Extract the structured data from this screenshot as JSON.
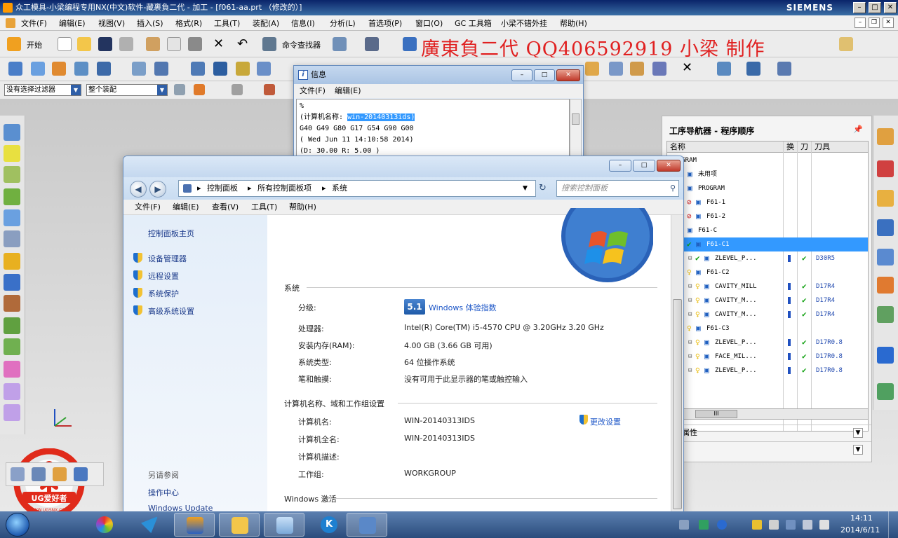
{
  "nx": {
    "title": "众工模具-小梁编程专用NX(中文)软件-藏裹負二代 - 加工 - [f061-aa.prt （修改的）]",
    "brand": "SIEMENS",
    "menu": [
      "文件(F)",
      "编辑(E)",
      "视图(V)",
      "插入(S)",
      "格式(R)",
      "工具(T)",
      "装配(A)",
      "信息(I)",
      "分析(L)",
      "首选项(P)",
      "窗口(O)",
      "GC 工具箱",
      "小梁不错外挂",
      "帮助(H)"
    ],
    "toolbar": {
      "start_label": "开始",
      "command_finder_label": "命令查找器"
    },
    "watermark_text": "廣東負二代 QQ406592919 小梁 制作",
    "selection_filter": "没有选择过滤器",
    "assembly_scope": "整个装配"
  },
  "navigator": {
    "title": "工序导航器 - 程序顺序",
    "columns": [
      "名称",
      "换",
      "刀",
      "刀具"
    ],
    "rows": [
      {
        "name": "PROGRAM",
        "indent": 0,
        "glyph": "",
        "check": "",
        "tool": "",
        "selected": false
      },
      {
        "name": "未用项",
        "indent": 1,
        "glyph": "folder",
        "check": "",
        "tool": "",
        "selected": false
      },
      {
        "name": "PROGRAM",
        "indent": 1,
        "glyph": "noentry",
        "check": "",
        "tool": "",
        "selected": false
      },
      {
        "name": "F61-1",
        "indent": 2,
        "glyph": "noentry",
        "check": "",
        "tool": "",
        "selected": false
      },
      {
        "name": "F61-2",
        "indent": 2,
        "glyph": "noentry",
        "check": "",
        "tool": "",
        "selected": false
      },
      {
        "name": "F61-C",
        "indent": 1,
        "glyph": "bulb",
        "check": "",
        "tool": "",
        "selected": false
      },
      {
        "name": "F61-C1",
        "indent": 2,
        "glyph": "check",
        "check": "",
        "tool": "",
        "selected": true
      },
      {
        "name": "ZLEVEL_P...",
        "indent": 3,
        "glyph": "check",
        "check": "✔",
        "tool": "D30R5",
        "selected": false
      },
      {
        "name": "F61-C2",
        "indent": 2,
        "glyph": "bulb",
        "check": "",
        "tool": "",
        "selected": false
      },
      {
        "name": "CAVITY_MILL",
        "indent": 3,
        "glyph": "bulb",
        "check": "✔",
        "tool": "D17R4",
        "selected": false
      },
      {
        "name": "CAVITY_M...",
        "indent": 3,
        "glyph": "bulb",
        "check": "✔",
        "tool": "D17R4",
        "selected": false
      },
      {
        "name": "CAVITY_M...",
        "indent": 3,
        "glyph": "bulb",
        "check": "✔",
        "tool": "D17R4",
        "selected": false
      },
      {
        "name": "F61-C3",
        "indent": 2,
        "glyph": "bulb",
        "check": "",
        "tool": "",
        "selected": false
      },
      {
        "name": "ZLEVEL_P...",
        "indent": 3,
        "glyph": "bulb",
        "check": "✔",
        "tool": "D17R0.8",
        "selected": false
      },
      {
        "name": "FACE_MIL...",
        "indent": 3,
        "glyph": "bulb",
        "check": "✔",
        "tool": "D17R0.8",
        "selected": false
      },
      {
        "name": "ZLEVEL_P...",
        "indent": 3,
        "glyph": "bulb",
        "check": "✔",
        "tool": "D17R0.8",
        "selected": false
      }
    ],
    "section_attributes": "属性",
    "section_other": "",
    "scroll_thumb_label": "III"
  },
  "info": {
    "title": "信息",
    "menu": [
      "文件(F)",
      "编辑(E)"
    ],
    "line0": "%",
    "line1_prefix": "(计算机名称: ",
    "line1_highlight": "win-20140313ids)",
    "line2": "G40 G49 G80 G17 G54 G90 G00",
    "line3": "( Wed Jun 11 14:10:58 2014)",
    "line4": "(D: 30.00 R: 5.00 )"
  },
  "system": {
    "breadcrumb": [
      "控制面板",
      "所有控制面板项",
      "系统"
    ],
    "search_placeholder": "搜索控制面板",
    "menu": [
      "文件(F)",
      "编辑(E)",
      "查看(V)",
      "工具(T)",
      "帮助(H)"
    ],
    "sidebar": {
      "home": "控制面板主页",
      "links": [
        "设备管理器",
        "远程设置",
        "系统保护",
        "高级系统设置"
      ],
      "see_also": "另请参阅",
      "action_center": "操作中心",
      "windows_update": "Windows Update"
    },
    "section_system": "系统",
    "rating_label": "分级:",
    "rating_badge": "5.1",
    "rating_link": "Windows 体验指数",
    "processor_label": "处理器:",
    "processor_value": "Intel(R) Core(TM) i5-4570 CPU @ 3.20GHz   3.20 GHz",
    "ram_label": "安装内存(RAM):",
    "ram_value": "4.00 GB (3.66 GB 可用)",
    "type_label": "系统类型:",
    "type_value": "64 位操作系统",
    "pen_label": "笔和触摸:",
    "pen_value": "没有可用于此显示器的笔或触控输入",
    "section_computer": "计算机名称、域和工作组设置",
    "computer_name_label": "计算机名:",
    "computer_name_value": "WIN-20140313IDS",
    "full_name_label": "计算机全名:",
    "full_name_value": "WIN-20140313IDS",
    "description_label": "计算机描述:",
    "workgroup_label": "工作组:",
    "workgroup_value": "WORKGROUP",
    "change_settings": "更改设置",
    "section_activation": "Windows 激活"
  },
  "taskbar": {
    "time": "14:11",
    "date": "2014/6/11"
  },
  "ug_logo": {
    "text": "UG爱好者",
    "url": "WWW.UGSNX.COM"
  },
  "colors": {
    "selection_blue": "#3399ff",
    "watermark_red": "#e02020",
    "check_green": "#10a010",
    "link_blue": "#1b55c7"
  }
}
